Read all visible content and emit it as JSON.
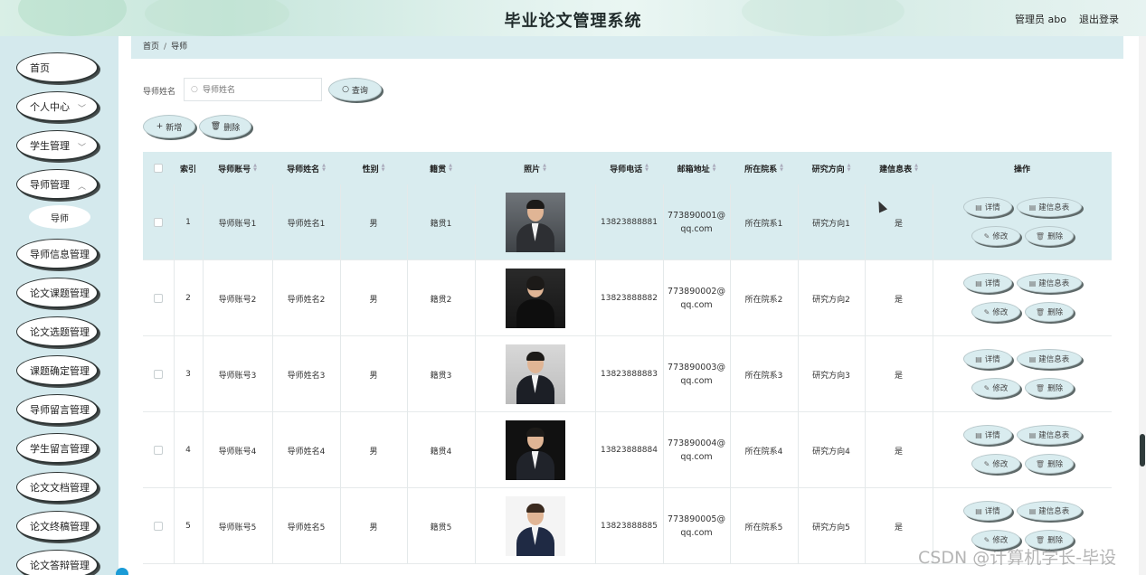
{
  "header": {
    "title": "毕业论文管理系统",
    "user": "管理员 abo",
    "logout": "退出登录"
  },
  "sidebar": {
    "items": [
      {
        "label": "首页",
        "has_chevron": false
      },
      {
        "label": "个人中心",
        "has_chevron": true
      },
      {
        "label": "学生管理",
        "has_chevron": true
      },
      {
        "label": "导师管理",
        "has_chevron": true
      },
      {
        "label": "导师信息管理",
        "has_chevron": false
      },
      {
        "label": "论文课题管理",
        "has_chevron": false
      },
      {
        "label": "论文选题管理",
        "has_chevron": false
      },
      {
        "label": "课题确定管理",
        "has_chevron": false
      },
      {
        "label": "导师留言管理",
        "has_chevron": false
      },
      {
        "label": "学生留言管理",
        "has_chevron": false
      },
      {
        "label": "论文文档管理",
        "has_chevron": false
      },
      {
        "label": "论文终稿管理",
        "has_chevron": false
      },
      {
        "label": "论文答辩管理",
        "has_chevron": false
      }
    ],
    "submenu": {
      "label": "导师"
    }
  },
  "breadcrumb": {
    "home": "首页",
    "sep": "/",
    "current": "导师"
  },
  "search": {
    "label": "导师姓名",
    "placeholder": "导师姓名",
    "query_button": "查询"
  },
  "toolbar": {
    "add_button": "新增",
    "delete_button": "删除"
  },
  "table": {
    "columns": [
      "索引",
      "导师账号",
      "导师姓名",
      "性别",
      "籍贯",
      "照片",
      "导师电话",
      "邮箱地址",
      "所在院系",
      "研究方向",
      "建信息表",
      "操作"
    ],
    "rows": [
      {
        "index": "1",
        "account": "导师账号1",
        "name": "导师姓名1",
        "gender": "男",
        "origin": "籍贯1",
        "phone": "13823888881",
        "email_a": "773890001@",
        "email_b": "qq.com",
        "dept": "所在院系1",
        "research": "研究方向1",
        "info": "是"
      },
      {
        "index": "2",
        "account": "导师账号2",
        "name": "导师姓名2",
        "gender": "男",
        "origin": "籍贯2",
        "phone": "13823888882",
        "email_a": "773890002@",
        "email_b": "qq.com",
        "dept": "所在院系2",
        "research": "研究方向2",
        "info": "是"
      },
      {
        "index": "3",
        "account": "导师账号3",
        "name": "导师姓名3",
        "gender": "男",
        "origin": "籍贯3",
        "phone": "13823888883",
        "email_a": "773890003@",
        "email_b": "qq.com",
        "dept": "所在院系3",
        "research": "研究方向3",
        "info": "是"
      },
      {
        "index": "4",
        "account": "导师账号4",
        "name": "导师姓名4",
        "gender": "男",
        "origin": "籍贯4",
        "phone": "13823888884",
        "email_a": "773890004@",
        "email_b": "qq.com",
        "dept": "所在院系4",
        "research": "研究方向4",
        "info": "是"
      },
      {
        "index": "5",
        "account": "导师账号5",
        "name": "导师姓名5",
        "gender": "男",
        "origin": "籍贯5",
        "phone": "13823888885",
        "email_a": "773890005@",
        "email_b": "qq.com",
        "dept": "所在院系5",
        "research": "研究方向5",
        "info": "是"
      }
    ],
    "actions": {
      "detail": "详情",
      "info_table": "建信息表",
      "edit": "修改",
      "delete": "删除"
    }
  },
  "watermark": "CSDN @计算机学长-毕设",
  "colors": {
    "sidebar_bg": "#d4e9ed",
    "accent": "#d9ecef",
    "header_bg": "#d9efe6"
  }
}
